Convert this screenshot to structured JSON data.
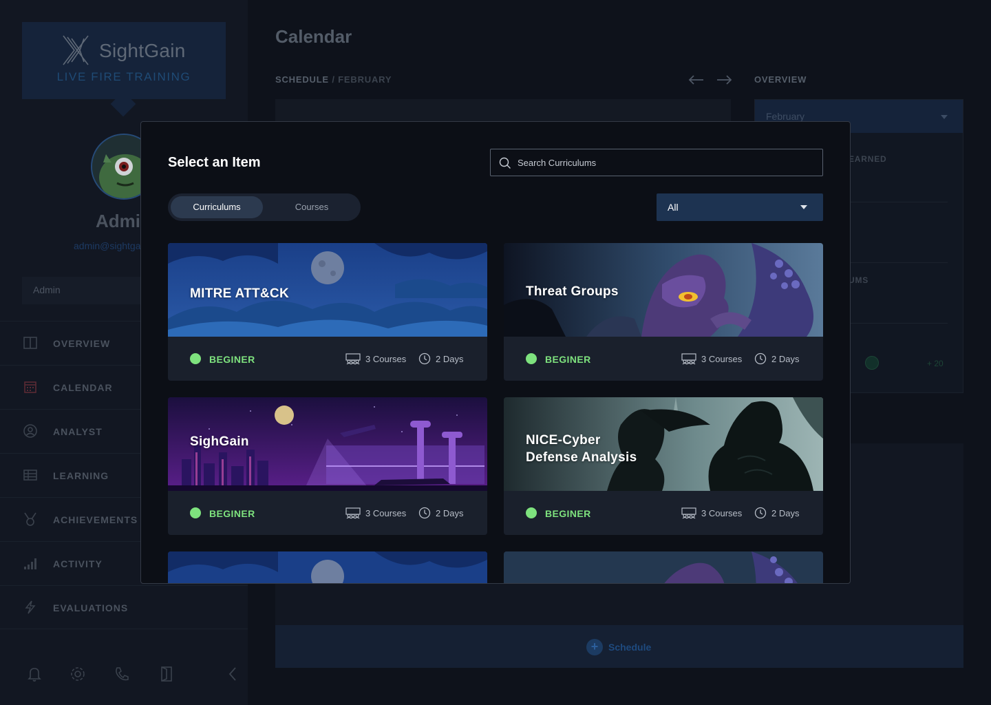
{
  "app": {
    "logo_name": "SightGain",
    "logo_tagline": "LIVE FIRE TRAINING",
    "user_name": "Admin",
    "user_email": "admin@sightgain.com",
    "role": "Admin"
  },
  "nav": [
    {
      "label": "OVERVIEW",
      "icon": "book-icon"
    },
    {
      "label": "CALENDAR",
      "icon": "calendar-icon"
    },
    {
      "label": "ANALYST",
      "icon": "user-circle-icon"
    },
    {
      "label": "LEARNING",
      "icon": "table-icon"
    },
    {
      "label": "ACHIEVEMENTS",
      "icon": "medal-icon"
    },
    {
      "label": "ACTIVITY",
      "icon": "bar-chart-icon"
    },
    {
      "label": "EVALUATIONS",
      "icon": "lightning-icon"
    }
  ],
  "page": {
    "title": "Calendar",
    "breadcrumb_root": "SCHEDULE",
    "breadcrumb_sep": "/",
    "breadcrumb_current": "FEBRUARY",
    "overview_label": "OVERVIEW",
    "overview_month": "February",
    "overview_fragment_1": "EARNED",
    "overview_fragment_2": "UMS",
    "overview_fragment_3": "n",
    "overview_more": "+ 20",
    "schedule_button": "Schedule"
  },
  "modal": {
    "title": "Select an Item",
    "search_placeholder": "Search Curriculums",
    "search_value": "",
    "tabs": [
      {
        "label": "Curriculums",
        "active": true
      },
      {
        "label": "Courses",
        "active": false
      }
    ],
    "filter_value": "All"
  },
  "cards": [
    {
      "title": "MITRE ATT&CK",
      "level": "BEGINER",
      "courses": "3 Courses",
      "days": "2 Days",
      "art": "night-sky"
    },
    {
      "title": "Threat Groups",
      "level": "BEGINER",
      "courses": "3 Courses",
      "days": "2 Days",
      "art": "dragon"
    },
    {
      "title": "SighGain",
      "level": "BEGINER",
      "courses": "3 Courses",
      "days": "2 Days",
      "art": "night-city"
    },
    {
      "title": "NICE-Cyber\nDefense Analysis",
      "level": "BEGINER",
      "courses": "3 Courses",
      "days": "2 Days",
      "art": "heroes"
    },
    {
      "title": "",
      "level": "",
      "courses": "",
      "days": "",
      "art": "night-sky"
    },
    {
      "title": "",
      "level": "",
      "courses": "",
      "days": "",
      "art": "dragon"
    }
  ],
  "colors": {
    "level_green": "#7ee27e",
    "accent_blue": "#1d3351",
    "modal_bg": "#0c0f16"
  }
}
